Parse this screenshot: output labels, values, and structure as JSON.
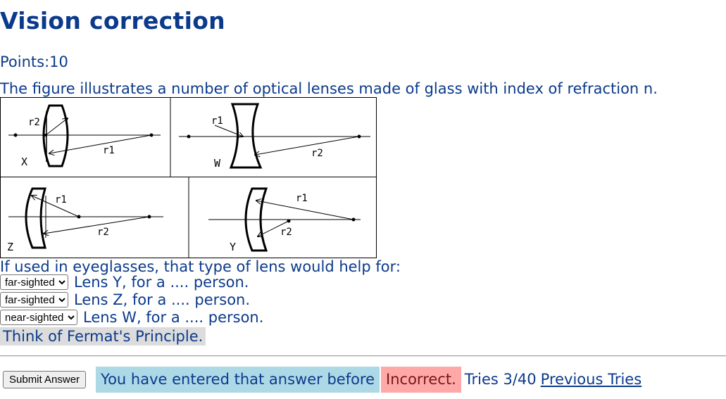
{
  "problem": {
    "title": "Vision correction",
    "points_label": "Points:",
    "points_value": "10",
    "intro": "The figure illustrates a number of optical lenses made of glass with index of refraction n.",
    "question": "If used in eyeglasses, that type of lens would help for:"
  },
  "figure": {
    "panels": [
      {
        "lens_label": "X",
        "r_labels": [
          "r2",
          "r1"
        ]
      },
      {
        "lens_label": "W",
        "r_labels": [
          "r1",
          "r2"
        ]
      },
      {
        "lens_label": "Z",
        "r_labels": [
          "r1",
          "r2"
        ]
      },
      {
        "lens_label": "Y",
        "r_labels": [
          "r1",
          "r2"
        ]
      }
    ]
  },
  "answers": [
    {
      "selected": "far-sighted",
      "text": "Lens Y, for a .... person."
    },
    {
      "selected": "far-sighted",
      "text": "Lens Z, for a .... person."
    },
    {
      "selected": "near-sighted",
      "text": "Lens W, for a .... person."
    }
  ],
  "hint": "Think of Fermat's Principle.",
  "submission": {
    "submit_label": "Submit Answer",
    "status_message": "You have entered that answer before",
    "result": "Incorrect.",
    "tries": "Tries 3/40",
    "previous_tries_link": "Previous Tries"
  }
}
